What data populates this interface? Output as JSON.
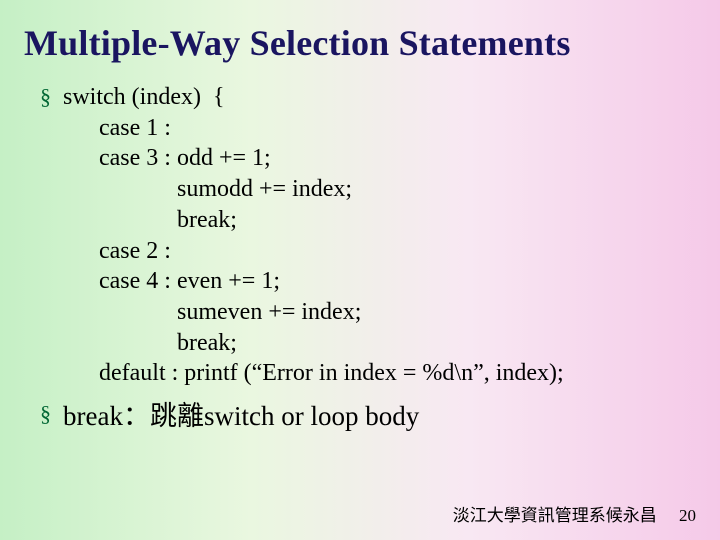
{
  "title": "Multiple-Way Selection Statements",
  "bullets": [
    {
      "lines": [
        "switch (index)  {",
        "      case 1 :",
        "      case 3 : odd += 1;",
        "                   sumodd += index;",
        "                   break;",
        "      case 2 :",
        "      case 4 : even += 1;",
        "                   sumeven += index;",
        "                   break;",
        "      default : printf (“Error in index = %d\\n”, index);"
      ]
    },
    {
      "lines": [
        "break：跳離switch or loop body"
      ]
    }
  ],
  "footer": {
    "author": "淡江大學資訊管理系候永昌",
    "page": "20"
  },
  "bullet_glyph": "§"
}
